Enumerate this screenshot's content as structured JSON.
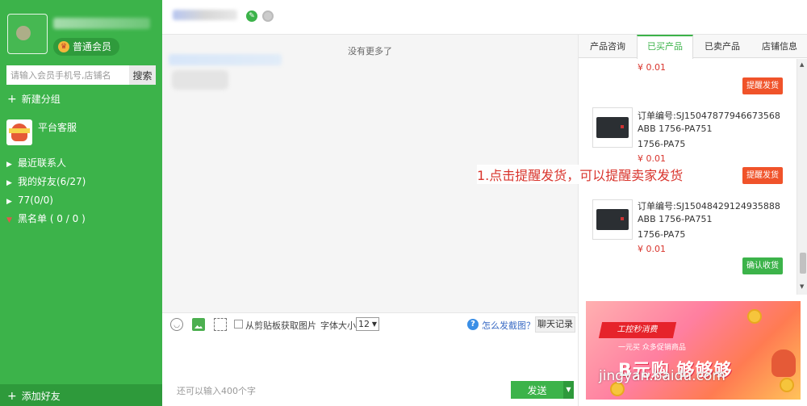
{
  "sidebar": {
    "member_badge": "普通会员",
    "search": {
      "placeholder": "请输入会员手机号,店铺名",
      "button": "搜索"
    },
    "new_group": "新建分组",
    "service_name": "平台客服",
    "groups": [
      {
        "label": "最近联系人"
      },
      {
        "label": "我的好友(6/27)"
      },
      {
        "label": "77(0/0)"
      },
      {
        "label": "黑名单 ( 0 / 0 )"
      }
    ],
    "add_friend": "添加好友"
  },
  "chat": {
    "no_more": "没有更多了"
  },
  "toolbar": {
    "clipboard_label": "从剪贴板获取图片",
    "font_size_label": "字体大小",
    "font_size_value": "12",
    "help_link": "怎么发截图？",
    "history_button": "聊天记录"
  },
  "input": {
    "char_count": "还可以输入400个字",
    "send_button": "发送"
  },
  "right_panel": {
    "tabs": [
      "产品咨询",
      "已买产品",
      "已卖产品",
      "店铺信息"
    ],
    "active_tab": "已买产品",
    "top_price": "¥ 0.01",
    "orders": [
      {
        "order_no": "订单编号:SJ15047877946673568",
        "line1": "ABB 1756-PA751",
        "line2": "1756-PA75",
        "price": "¥ 0.01",
        "action": "提醒发货"
      },
      {
        "order_no": "订单编号:SJ15048429124935888",
        "line1": "ABB 1756-PA751",
        "line2": "1756-PA75",
        "price": "¥ 0.01",
        "action": "确认收货"
      }
    ],
    "first_action": "提醒发货"
  },
  "banner": {
    "flag": "工控秒消费",
    "sub": "一元买  众多促销商品",
    "big": "B元购 够够够"
  },
  "annotation": "1.点击提醒发货，可以提醒卖家发货",
  "watermark": "jingyan.baidu.com",
  "colors": {
    "accent": "#3cb34a",
    "danger": "#f0532a",
    "price": "#d9352d"
  }
}
